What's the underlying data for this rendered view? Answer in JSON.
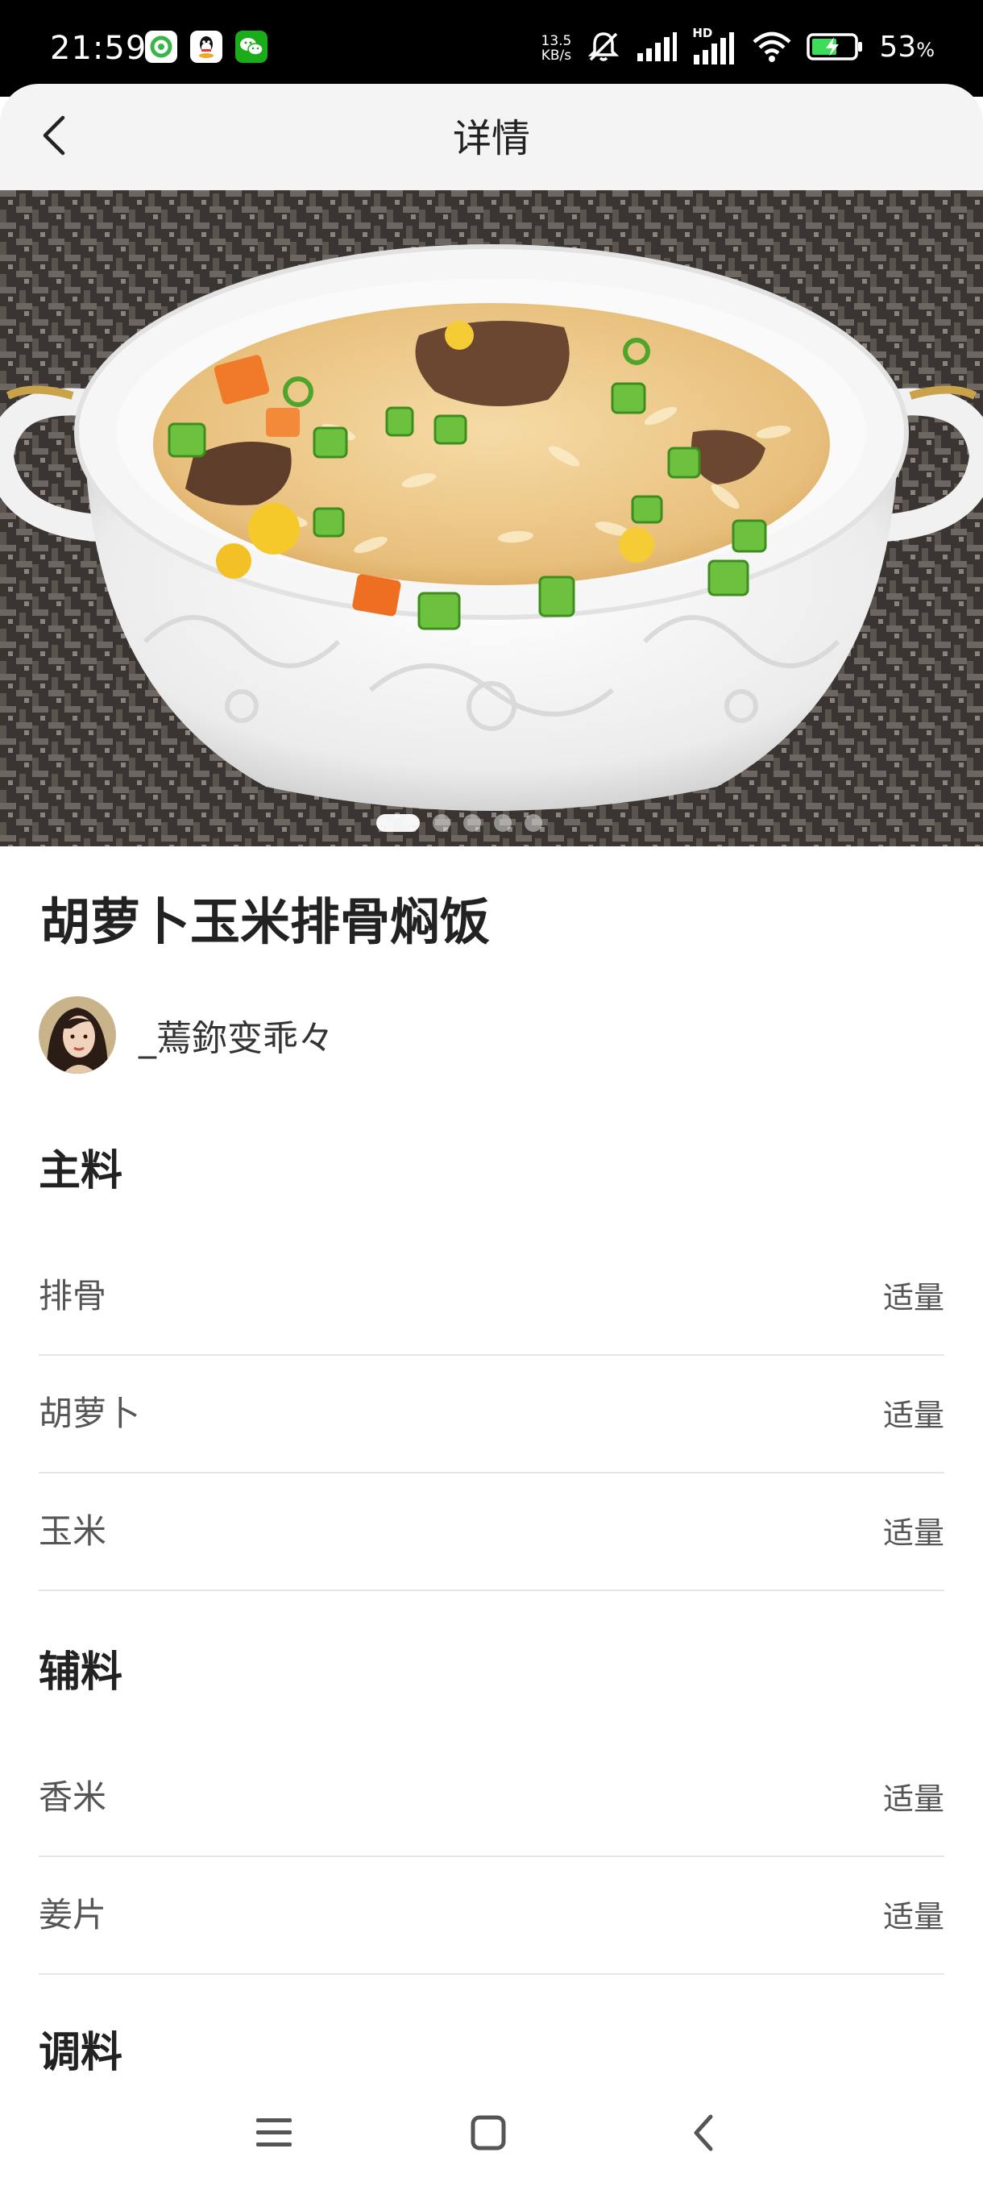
{
  "status_bar": {
    "time": "21:59",
    "net_speed_value": "13.5",
    "net_speed_unit": "KB/s",
    "hd_label": "HD",
    "battery_percent": "53",
    "battery_unit": "%",
    "app_icons": [
      "green-swirl-app-icon",
      "qq-icon",
      "wechat-icon"
    ]
  },
  "header": {
    "title": "详情"
  },
  "hero": {
    "slide_count": 5,
    "active_slide": 1
  },
  "recipe": {
    "title": "胡萝卜玉米排骨焖饭",
    "author": "_蔫鉨变乖々"
  },
  "sections": [
    {
      "title": "主料",
      "items": [
        {
          "name": "排骨",
          "amount": "适量"
        },
        {
          "name": "胡萝卜",
          "amount": "适量"
        },
        {
          "name": "玉米",
          "amount": "适量"
        }
      ]
    },
    {
      "title": "辅料",
      "items": [
        {
          "name": "香米",
          "amount": "适量"
        },
        {
          "name": "姜片",
          "amount": "适量"
        }
      ]
    },
    {
      "title": "调料",
      "items": []
    }
  ],
  "colors": {
    "header_bg": "#f4f4f4",
    "text_primary": "#222222",
    "text_secondary": "#555555",
    "divider": "#e6e6e6"
  }
}
